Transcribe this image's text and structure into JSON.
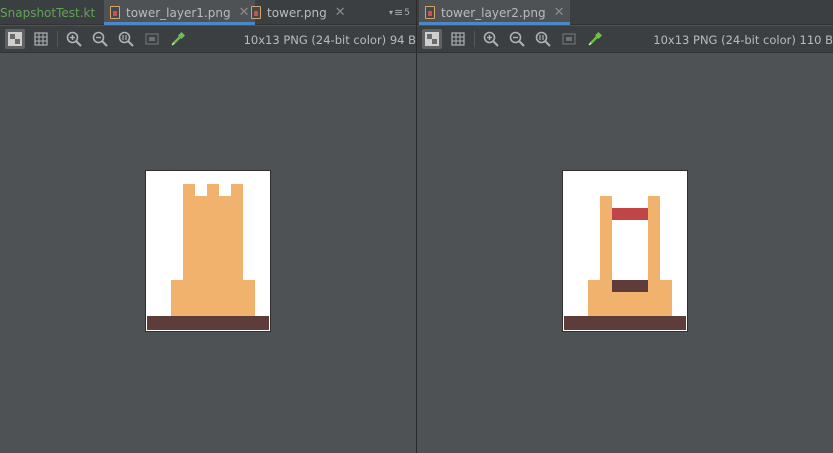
{
  "left_pane": {
    "tabs": [
      {
        "label": "SnapshotTest.kt"
      },
      {
        "label": "tower_layer1.png"
      },
      {
        "label": "tower.png"
      }
    ],
    "tab_overflow": "5",
    "image_info": "10x13 PNG (24-bit color) 94 B"
  },
  "right_pane": {
    "tabs": [
      {
        "label": "tower_layer2.png"
      }
    ],
    "image_info": "10x13 PNG (24-bit color) 110 B"
  },
  "colors": {
    "tower_orange": "#f0b26c",
    "base_brown": "#5e3c3a",
    "band_red": "#c04646",
    "active_tab_underline": "#4a88c7"
  },
  "icons": [
    "checkerboard-icon",
    "grid-icon",
    "zoom-in-icon",
    "zoom-out-icon",
    "actual-size-icon",
    "fit-zoom-icon",
    "color-picker-icon"
  ]
}
